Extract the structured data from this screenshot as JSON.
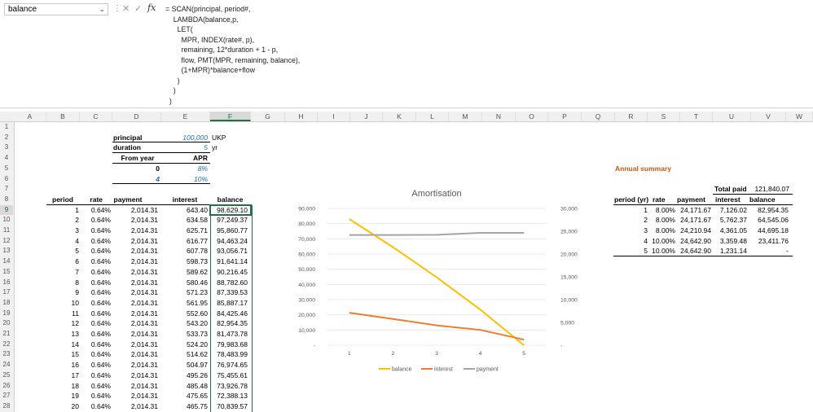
{
  "name_box": {
    "value": "balance",
    "dropdown": "⌄"
  },
  "formula_bar": {
    "cancel_icon": "✕",
    "enter_icon": "✓",
    "fx_label": "fx",
    "lines": [
      "= SCAN(principal, period#,",
      "    LAMBDA(balance,p,",
      "      LET(",
      "        MPR, INDEX(rate#, p),",
      "        remaining, 12*duration + 1 - p,",
      "        flow, PMT(MPR, remaining, balance),",
      "        (1+MPR)*balance+flow",
      "      )",
      "    )",
      "  )"
    ]
  },
  "columns": [
    "A",
    "B",
    "C",
    "D",
    "E",
    "F",
    "G",
    "H",
    "I",
    "J",
    "K",
    "L",
    "M",
    "N",
    "O",
    "P",
    "Q",
    "R",
    "S",
    "T",
    "U",
    "V",
    "W"
  ],
  "selected_column": "F",
  "selected_row": 9,
  "rows": [
    1,
    2,
    3,
    4,
    5,
    6,
    7,
    8,
    9,
    10,
    11,
    12,
    13,
    14,
    15,
    16,
    17,
    18,
    19,
    20,
    21,
    22,
    23,
    24,
    25,
    26,
    27,
    28
  ],
  "inputs": {
    "principal_label": "principal",
    "principal_value": "100,000",
    "principal_unit": "UKP",
    "duration_label": "duration",
    "duration_value": "5",
    "duration_unit": "yr",
    "from_year_header": "From year",
    "apr_header": "APR",
    "rate_rows": [
      {
        "year": "0",
        "apr": "8%"
      },
      {
        "year": "4",
        "apr": "10%"
      }
    ]
  },
  "schedule": {
    "headers": [
      "period",
      "rate",
      "payment",
      "interest",
      "balance"
    ],
    "rows": [
      [
        "1",
        "0.64%",
        "2,014.31",
        "643.40",
        "98,629.10"
      ],
      [
        "2",
        "0.64%",
        "2,014.31",
        "634.58",
        "97,249.37"
      ],
      [
        "3",
        "0.64%",
        "2,014.31",
        "625.71",
        "95,860.77"
      ],
      [
        "4",
        "0.64%",
        "2,014.31",
        "616.77",
        "94,463.24"
      ],
      [
        "5",
        "0.64%",
        "2,014.31",
        "607.78",
        "93,056.71"
      ],
      [
        "6",
        "0.64%",
        "2,014.31",
        "598.73",
        "91,641.14"
      ],
      [
        "7",
        "0.64%",
        "2,014.31",
        "589.62",
        "90,216.45"
      ],
      [
        "8",
        "0.64%",
        "2,014.31",
        "580.46",
        "88,782.60"
      ],
      [
        "9",
        "0.64%",
        "2,014.31",
        "571.23",
        "87,339.53"
      ],
      [
        "10",
        "0.64%",
        "2,014.31",
        "561.95",
        "85,887.17"
      ],
      [
        "11",
        "0.64%",
        "2,014.31",
        "552.60",
        "84,425.46"
      ],
      [
        "12",
        "0.64%",
        "2,014.31",
        "543.20",
        "82,954.35"
      ],
      [
        "13",
        "0.64%",
        "2,014.31",
        "533.73",
        "81,473.78"
      ],
      [
        "14",
        "0.64%",
        "2,014.31",
        "524.20",
        "79,983.68"
      ],
      [
        "15",
        "0.64%",
        "2,014.31",
        "514.62",
        "78,483.99"
      ],
      [
        "16",
        "0.64%",
        "2,014.31",
        "504.97",
        "76,974.65"
      ],
      [
        "17",
        "0.64%",
        "2,014.31",
        "495.26",
        "75,455.61"
      ],
      [
        "18",
        "0.64%",
        "2,014.31",
        "485.48",
        "73,926.78"
      ],
      [
        "19",
        "0.64%",
        "2,014.31",
        "475.65",
        "72,388.13"
      ],
      [
        "20",
        "0.64%",
        "2,014.31",
        "465.75",
        "70,839.57"
      ]
    ]
  },
  "summary": {
    "title": "Annual summary",
    "total_paid_label": "Total paid",
    "total_paid_value": "121,840.07",
    "headers": [
      "period (yr)",
      "rate",
      "payment",
      "interest",
      "balance"
    ],
    "rows": [
      [
        "1",
        "8.00%",
        "24,171.67",
        "7,126.02",
        "82,954.35"
      ],
      [
        "2",
        "8.00%",
        "24,171.67",
        "5,762.37",
        "64,545.06"
      ],
      [
        "3",
        "8.00%",
        "24,210.94",
        "4,361.05",
        "44,695.18"
      ],
      [
        "4",
        "10.00%",
        "24,642.90",
        "3,359.48",
        "23,411.76"
      ],
      [
        "5",
        "10.00%",
        "24,642.90",
        "1,231.14",
        "-"
      ]
    ]
  },
  "chart_data": {
    "type": "line",
    "title": "Amortisation",
    "x": [
      1,
      2,
      3,
      4,
      5
    ],
    "y_left": {
      "ticks": [
        "-",
        "10,000",
        "20,000",
        "30,000",
        "40,000",
        "50,000",
        "60,000",
        "70,000",
        "80,000",
        "90,000"
      ],
      "ylim": [
        0,
        90000
      ]
    },
    "y_right": {
      "ticks": [
        "-",
        "5,000",
        "10,000",
        "15,000",
        "20,000",
        "25,000",
        "30,000"
      ],
      "ylim": [
        0,
        30000
      ]
    },
    "series": [
      {
        "name": "balance",
        "axis": "left",
        "color": "#ffc000",
        "values": [
          82954.35,
          64545.06,
          44695.18,
          23411.76,
          0
        ]
      },
      {
        "name": "interest",
        "axis": "right",
        "color": "#ed7d31",
        "values": [
          7126.02,
          5762.37,
          4361.05,
          3359.48,
          1231.14
        ]
      },
      {
        "name": "payment",
        "axis": "right",
        "color": "#a5a5a5",
        "values": [
          24171.67,
          24171.67,
          24210.94,
          24642.9,
          24642.9
        ]
      }
    ],
    "legend": "bottom",
    "grid": true
  }
}
